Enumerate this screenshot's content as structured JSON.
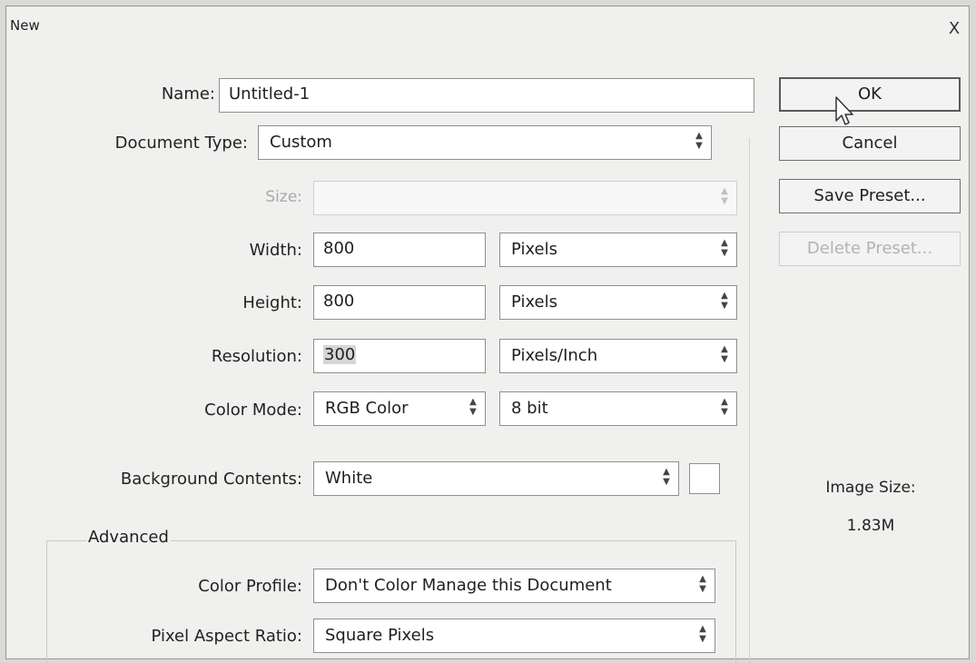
{
  "dialog": {
    "title": "New",
    "close_glyph": "X"
  },
  "form": {
    "name": {
      "label": "Name:",
      "value": "Untitled-1"
    },
    "document_type": {
      "label": "Document Type:",
      "value": "Custom"
    },
    "size": {
      "label": "Size:",
      "value": ""
    },
    "width": {
      "label": "Width:",
      "value": "800",
      "unit": "Pixels"
    },
    "height": {
      "label": "Height:",
      "value": "800",
      "unit": "Pixels"
    },
    "resolution": {
      "label": "Resolution:",
      "value": "300",
      "unit": "Pixels/Inch"
    },
    "color_mode": {
      "label": "Color Mode:",
      "mode": "RGB Color",
      "depth": "8 bit"
    },
    "background": {
      "label": "Background Contents:",
      "value": "White",
      "swatch_color": "#ffffff"
    },
    "advanced": {
      "title": "Advanced",
      "color_profile": {
        "label": "Color Profile:",
        "value": "Don't Color Manage this Document"
      },
      "pixel_aspect": {
        "label": "Pixel Aspect Ratio:",
        "value": "Square Pixels"
      }
    }
  },
  "buttons": {
    "ok": "OK",
    "cancel": "Cancel",
    "save_preset": "Save Preset...",
    "delete_preset": "Delete Preset..."
  },
  "image_size": {
    "label": "Image Size:",
    "value": "1.83M"
  },
  "icons": {
    "dropdown": "up-down-arrows-icon",
    "close": "close-icon",
    "cursor": "mouse-pointer-icon"
  }
}
